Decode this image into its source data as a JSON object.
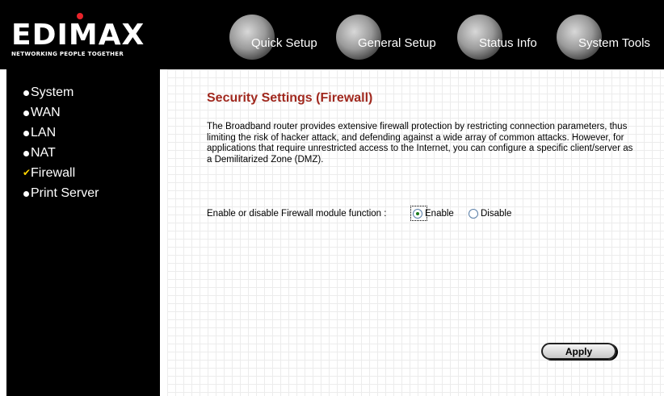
{
  "header": {
    "logo": "EDIMAX",
    "tagline": "NETWORKING PEOPLE TOGETHER",
    "nav": [
      {
        "label": "Quick Setup",
        "icon": "quick-setup-icon"
      },
      {
        "label": "General Setup",
        "icon": "general-setup-icon"
      },
      {
        "label": "Status Info",
        "icon": "status-info-icon"
      },
      {
        "label": "System Tools",
        "icon": "system-tools-icon"
      }
    ]
  },
  "sidebar": {
    "items": [
      {
        "label": "System",
        "icon": "bullet-icon"
      },
      {
        "label": "WAN",
        "icon": "bullet-icon"
      },
      {
        "label": "LAN",
        "icon": "bullet-icon"
      },
      {
        "label": "NAT",
        "icon": "bullet-icon"
      },
      {
        "label": "Firewall",
        "icon": "check-icon",
        "active": true
      },
      {
        "label": "Print Server",
        "icon": "bullet-icon"
      }
    ]
  },
  "main": {
    "title": "Security Settings (Firewall)",
    "description": "The Broadband router provides extensive firewall protection by restricting connection parameters, thus limiting the risk of hacker attack, and defending against a wide array of common attacks. However, for applications that require unrestricted access to the Internet, you can configure a specific client/server as a Demilitarized Zone (DMZ).",
    "firewall_label": "Enable or disable Firewall module function :",
    "options": [
      {
        "label": "Enable",
        "checked": true
      },
      {
        "label": "Disable",
        "checked": false
      }
    ],
    "apply_label": "Apply"
  },
  "colors": {
    "title": "#a0281e",
    "background_dark": "#000000",
    "accent_dot": "#e8232a"
  }
}
